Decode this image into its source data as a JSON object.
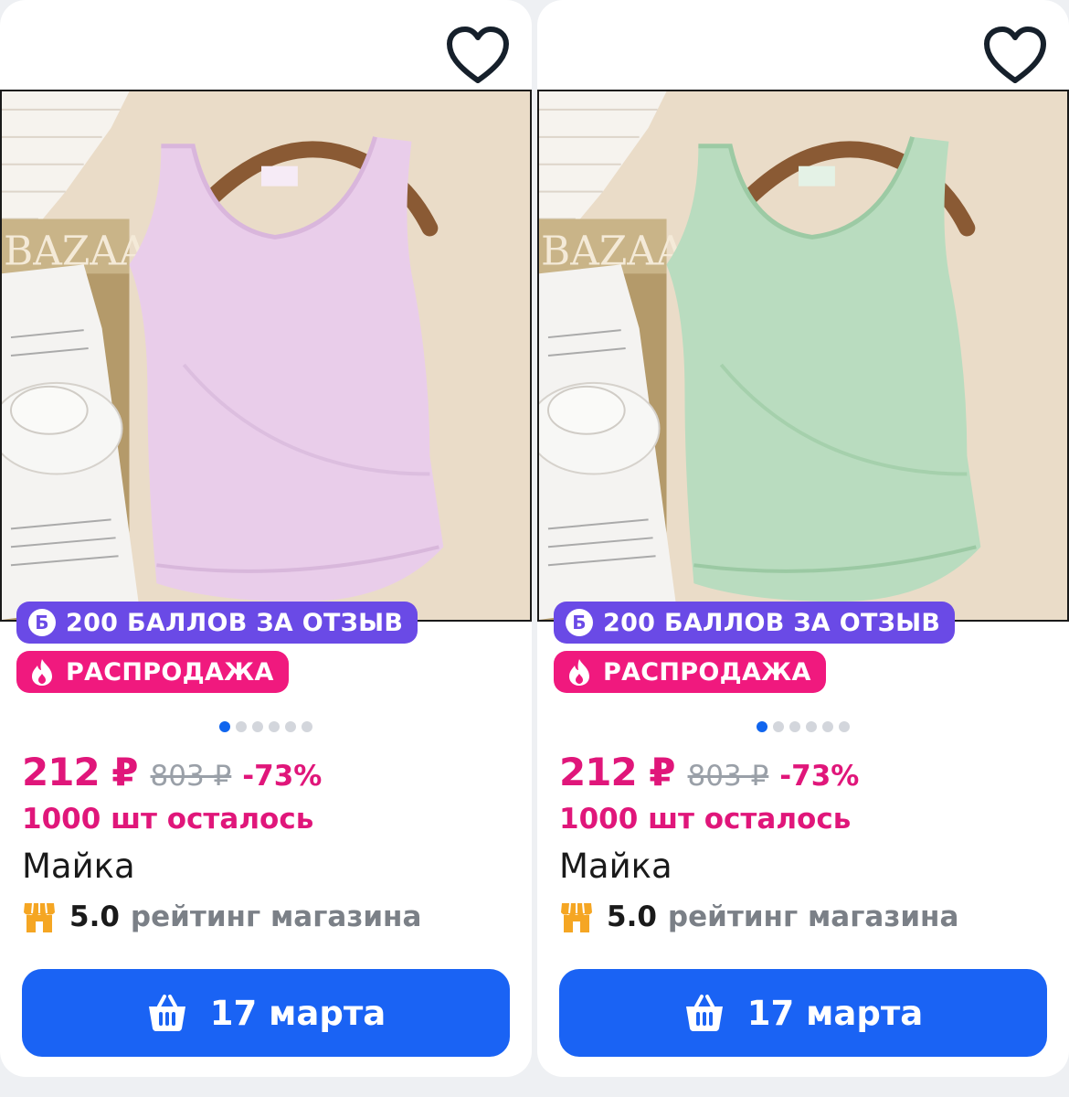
{
  "products": [
    {
      "favorite_icon": "heart-outline-icon",
      "image": {
        "color": "#e8cdea"
      },
      "badges": {
        "points_label": "200 БАЛЛОВ ЗА ОТЗЫВ",
        "points_icon_glyph": "Б",
        "sale_label": "РАСПРОДАЖА",
        "sale_icon": "flame-icon"
      },
      "gallery": {
        "count": 6,
        "active": 0
      },
      "price": "212 ₽",
      "old_price": "803 ₽",
      "discount": "-73%",
      "stock": "1000 шт осталось",
      "title": "Майка",
      "rating_value": "5.0",
      "rating_label": "рейтинг магазина",
      "cart_label": "17 марта"
    },
    {
      "favorite_icon": "heart-outline-icon",
      "image": {
        "color": "#b9dcbf"
      },
      "badges": {
        "points_label": "200 БАЛЛОВ ЗА ОТЗЫВ",
        "points_icon_glyph": "Б",
        "sale_label": "РАСПРОДАЖА",
        "sale_icon": "flame-icon"
      },
      "gallery": {
        "count": 6,
        "active": 0
      },
      "price": "212 ₽",
      "old_price": "803 ₽",
      "discount": "-73%",
      "stock": "1000 шт осталось",
      "title": "Майка",
      "rating_value": "5.0",
      "rating_label": "рейтинг магазина",
      "cart_label": "17 марта"
    }
  ],
  "colors": {
    "accent_pink": "#e0167a",
    "badge_points": "#6a4ae6",
    "badge_sale": "#f0197e",
    "button_blue": "#1a63f4",
    "shop_icon": "#f5a623"
  }
}
